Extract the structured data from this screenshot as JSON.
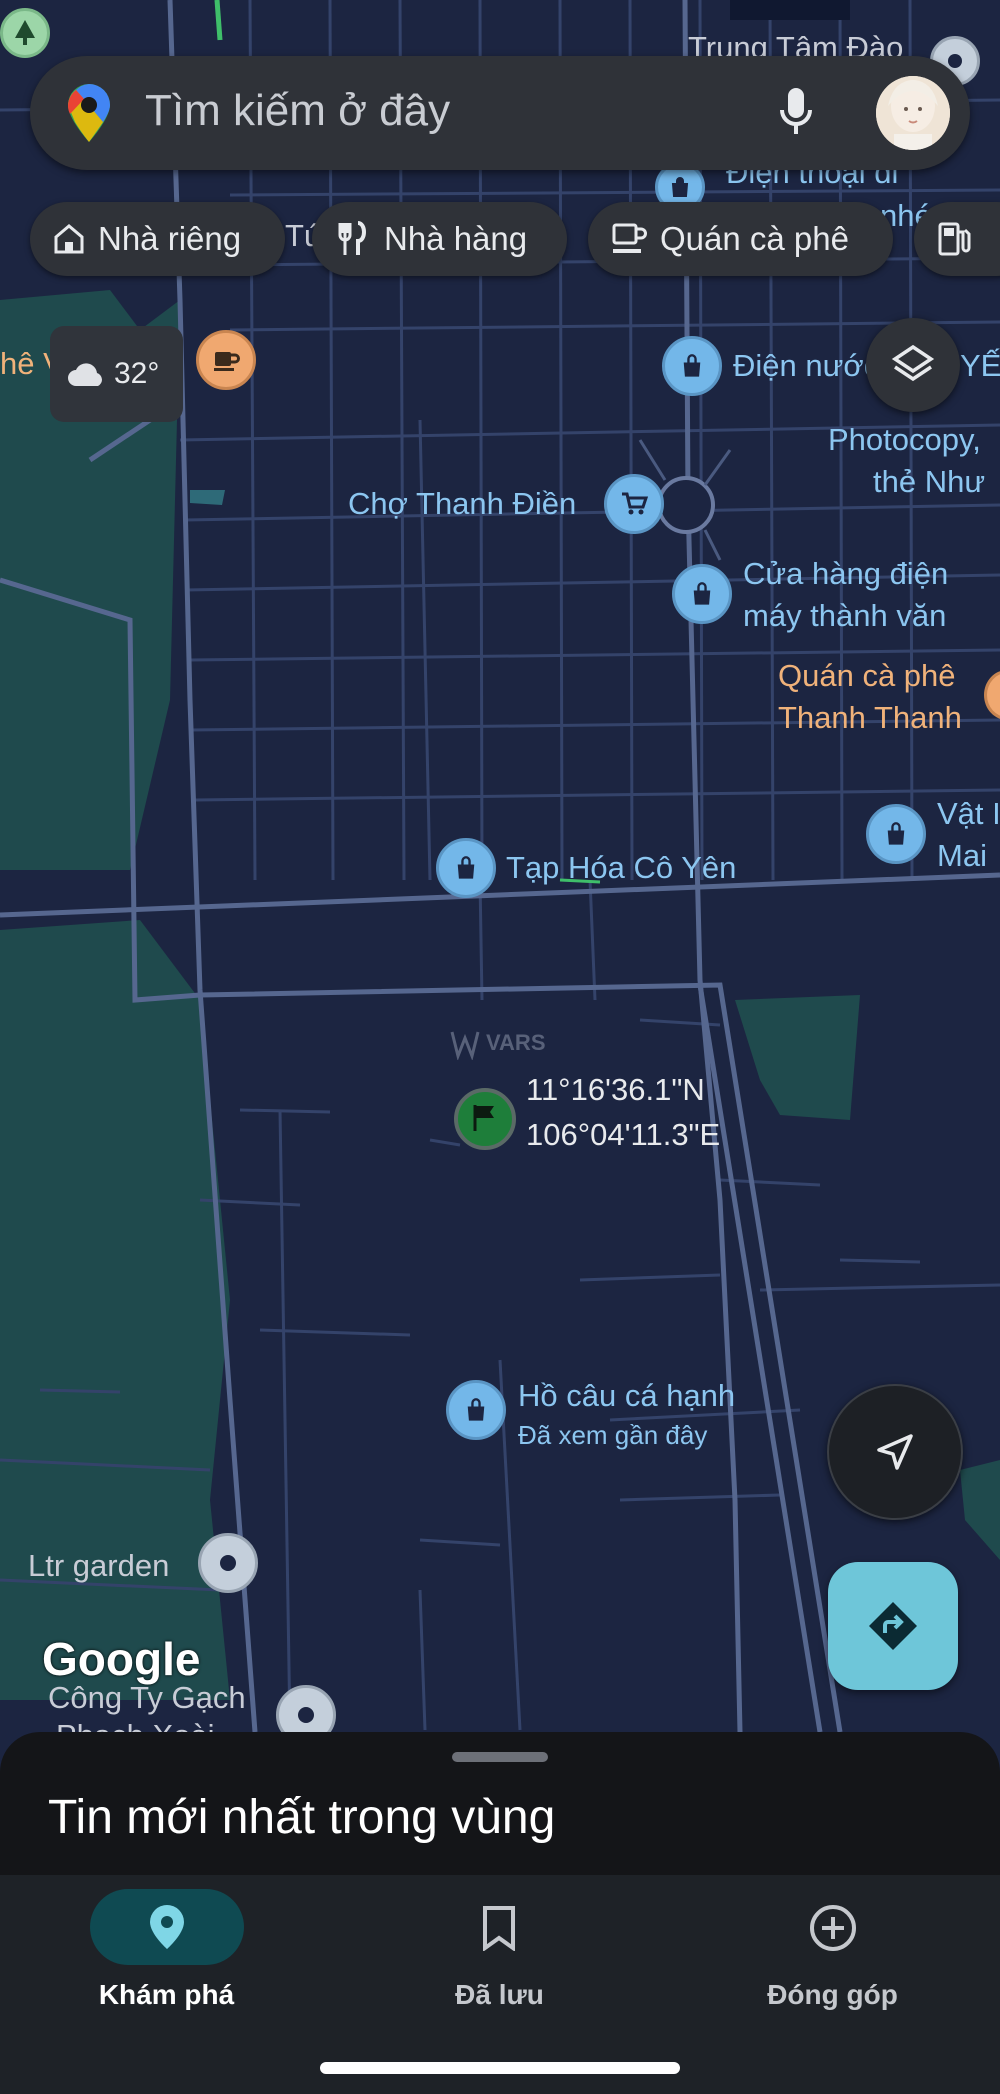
{
  "search": {
    "placeholder": "Tìm kiếm ở đây"
  },
  "chips": [
    {
      "label": "Nhà riêng",
      "icon": "home-icon"
    },
    {
      "label": "Nhà hàng",
      "icon": "restaurant-icon"
    },
    {
      "label": "Quán cà phê",
      "icon": "coffee-icon"
    }
  ],
  "weather": {
    "temperature": "32°",
    "icon": "cloud-icon"
  },
  "map_labels": {
    "trung_tam_dao": "Trung Tâm Đào",
    "dien_thoai_di": "Điện thoại di",
    "dien_thoai_di_2": "nhé",
    "tu_partial": "Tú",
    "phe_v_partial": "hê V",
    "dien_nuoc": "Điện nước",
    "yen_partial": "YẾ",
    "photocopy_1": "Photocopy,",
    "photocopy_2": "thẻ Như",
    "cho_thanh_dien": "Chợ Thanh Điền",
    "cua_hang_1": "Cửa hàng điện",
    "cua_hang_2": "máy thành văn",
    "quan_ca_phe_1": "Quán cà phê",
    "quan_ca_phe_2": "Thanh Thanh",
    "vat_1": "Vật I",
    "vat_2": "Mai",
    "tap_hoa": "Tạp Hóa Cô Yên",
    "watermark": "VARS",
    "coord_lat": "11°16'36.1\"N",
    "coord_lng": "106°04'11.3\"E",
    "ho_cau": "Hồ câu cá hạnh",
    "ho_cau_sub": "Đã xem gần đây",
    "ltr_garden": "Ltr garden",
    "google": "Google",
    "cong_ty_1": "Công Ty Gạch",
    "cong_ty_2": "Phạch Xoài"
  },
  "sheet": {
    "title": "Tin mới nhất trong vùng"
  },
  "nav": [
    {
      "label": "Khám phá",
      "icon": "explore-pin-icon",
      "active": true
    },
    {
      "label": "Đã lưu",
      "icon": "bookmark-icon",
      "active": false
    },
    {
      "label": "Đóng góp",
      "icon": "add-circle-icon",
      "active": false
    }
  ],
  "colors": {
    "map_bg": "#1c2541",
    "road": "#3a4a6e",
    "main_road": "#5a6a8e",
    "green_area": "#1f4a4d",
    "accent": "#6ec6d9",
    "poi_blue": "#8cc6f0",
    "poi_orange": "#f0b27a"
  }
}
